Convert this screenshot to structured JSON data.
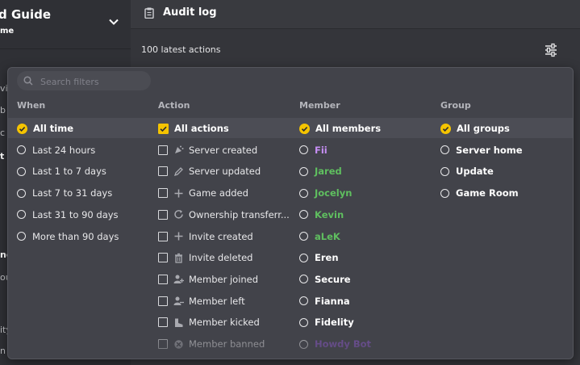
{
  "sidebar": {
    "title": "d Guide",
    "subtitle": "me",
    "fragments": [
      "vi",
      "b",
      "c",
      "t",
      "nc",
      "ou",
      "ity",
      "n"
    ]
  },
  "header": {
    "title": "Audit log"
  },
  "toolbar": {
    "count_label": "100 latest actions"
  },
  "filters": {
    "search_placeholder": "Search filters",
    "when": {
      "heading": "When",
      "options": [
        "All time",
        "Last 24 hours",
        "Last 1 to 7 days",
        "Last 7 to 31 days",
        "Last 31 to 90 days",
        "More than 90 days"
      ],
      "selected": "All time"
    },
    "action": {
      "heading": "Action",
      "options": [
        {
          "label": "All actions",
          "icon": "none"
        },
        {
          "label": "Server created",
          "icon": "confetti-icon"
        },
        {
          "label": "Server updated",
          "icon": "pencil-icon"
        },
        {
          "label": "Game added",
          "icon": "plus-icon"
        },
        {
          "label": "Ownership transferr...",
          "icon": "refresh-icon"
        },
        {
          "label": "Invite created",
          "icon": "plus-icon"
        },
        {
          "label": "Invite deleted",
          "icon": "trash-icon"
        },
        {
          "label": "Member joined",
          "icon": "user-plus-icon"
        },
        {
          "label": "Member left",
          "icon": "user-minus-icon"
        },
        {
          "label": "Member kicked",
          "icon": "boot-icon"
        },
        {
          "label": "Member banned",
          "icon": "ban-icon"
        }
      ],
      "selected": "All actions"
    },
    "member": {
      "heading": "Member",
      "options": [
        {
          "label": "All members",
          "color": "#ffffff"
        },
        {
          "label": "Fii",
          "color": "#c78ff5"
        },
        {
          "label": "Jared",
          "color": "#5fbf5f"
        },
        {
          "label": "Jocelyn",
          "color": "#5fbf5f"
        },
        {
          "label": "Kevin",
          "color": "#5fbf5f"
        },
        {
          "label": "aLeK",
          "color": "#5fbf5f"
        },
        {
          "label": "Eren",
          "color": "#ffffff"
        },
        {
          "label": "Secure",
          "color": "#ffffff"
        },
        {
          "label": "Fianna",
          "color": "#ffffff"
        },
        {
          "label": "Fidelity",
          "color": "#ffffff"
        },
        {
          "label": "Howdy Bot",
          "color": "#8a56c8"
        }
      ],
      "selected": "All members"
    },
    "group": {
      "heading": "Group",
      "options": [
        "All groups",
        "Server home",
        "Update",
        "Game Room"
      ],
      "selected": "All groups"
    }
  },
  "colors": {
    "accent": "#f5c400",
    "popover_bg": "#42434a",
    "selected_row": "#4c4d55"
  }
}
